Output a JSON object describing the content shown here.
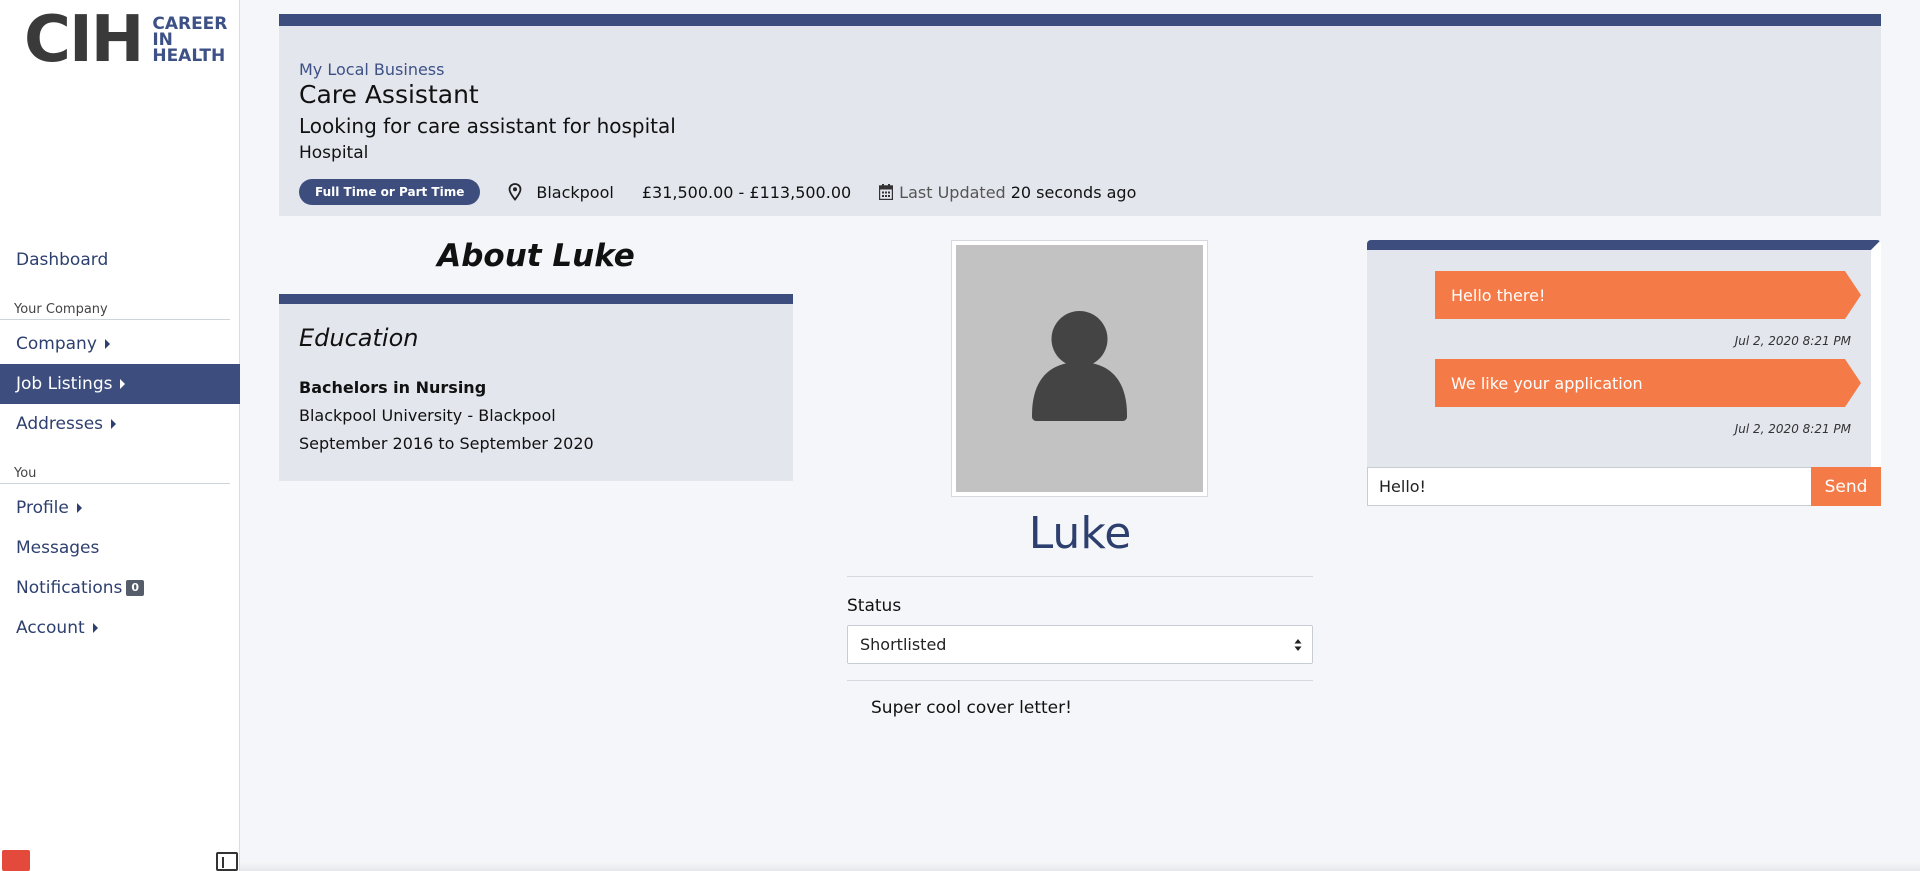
{
  "brand": {
    "logo_mark": "CIH",
    "logo_text": [
      "CAREER",
      "IN",
      "HEALTH"
    ]
  },
  "sidebar": {
    "items": [
      {
        "label": "Dashboard"
      },
      {
        "section": "Your Company"
      },
      {
        "label": "Company"
      },
      {
        "label": "Job Listings"
      },
      {
        "label": "Addresses"
      },
      {
        "section": "You"
      },
      {
        "label": "Profile"
      },
      {
        "label": "Messages"
      },
      {
        "label": "Notifications",
        "badge": "0"
      },
      {
        "label": "Account"
      }
    ]
  },
  "job": {
    "company": "My Local Business",
    "title": "Care Assistant",
    "description": "Looking for care assistant for hospital",
    "type": "Hospital",
    "employment_type": "Full Time or Part Time",
    "location": "Blackpool",
    "salary": "£31,500.00 - £113,500.00",
    "updated_label": "Last Updated",
    "updated_value": "20 seconds ago"
  },
  "about": {
    "title": "About Luke",
    "education_heading": "Education",
    "degree": "Bachelors in Nursing",
    "institution": "Blackpool University - Blackpool",
    "dates": "September 2016 to September 2020"
  },
  "candidate": {
    "name": "Luke",
    "status_label": "Status",
    "status_value": "Shortlisted",
    "cover_letter": "Super cool cover letter!"
  },
  "chat": {
    "messages": [
      {
        "text": "Hello there!",
        "time": "Jul 2, 2020 8:21 PM"
      },
      {
        "text": "We like your application",
        "time": "Jul 2, 2020 8:21 PM"
      }
    ],
    "input_value": "Hello!",
    "send_label": "Send"
  },
  "colors": {
    "navy": "#3d4e7e",
    "accent_orange": "#f47b48",
    "card_bg": "#e3e6ed",
    "page_bg": "#f5f6f9"
  }
}
